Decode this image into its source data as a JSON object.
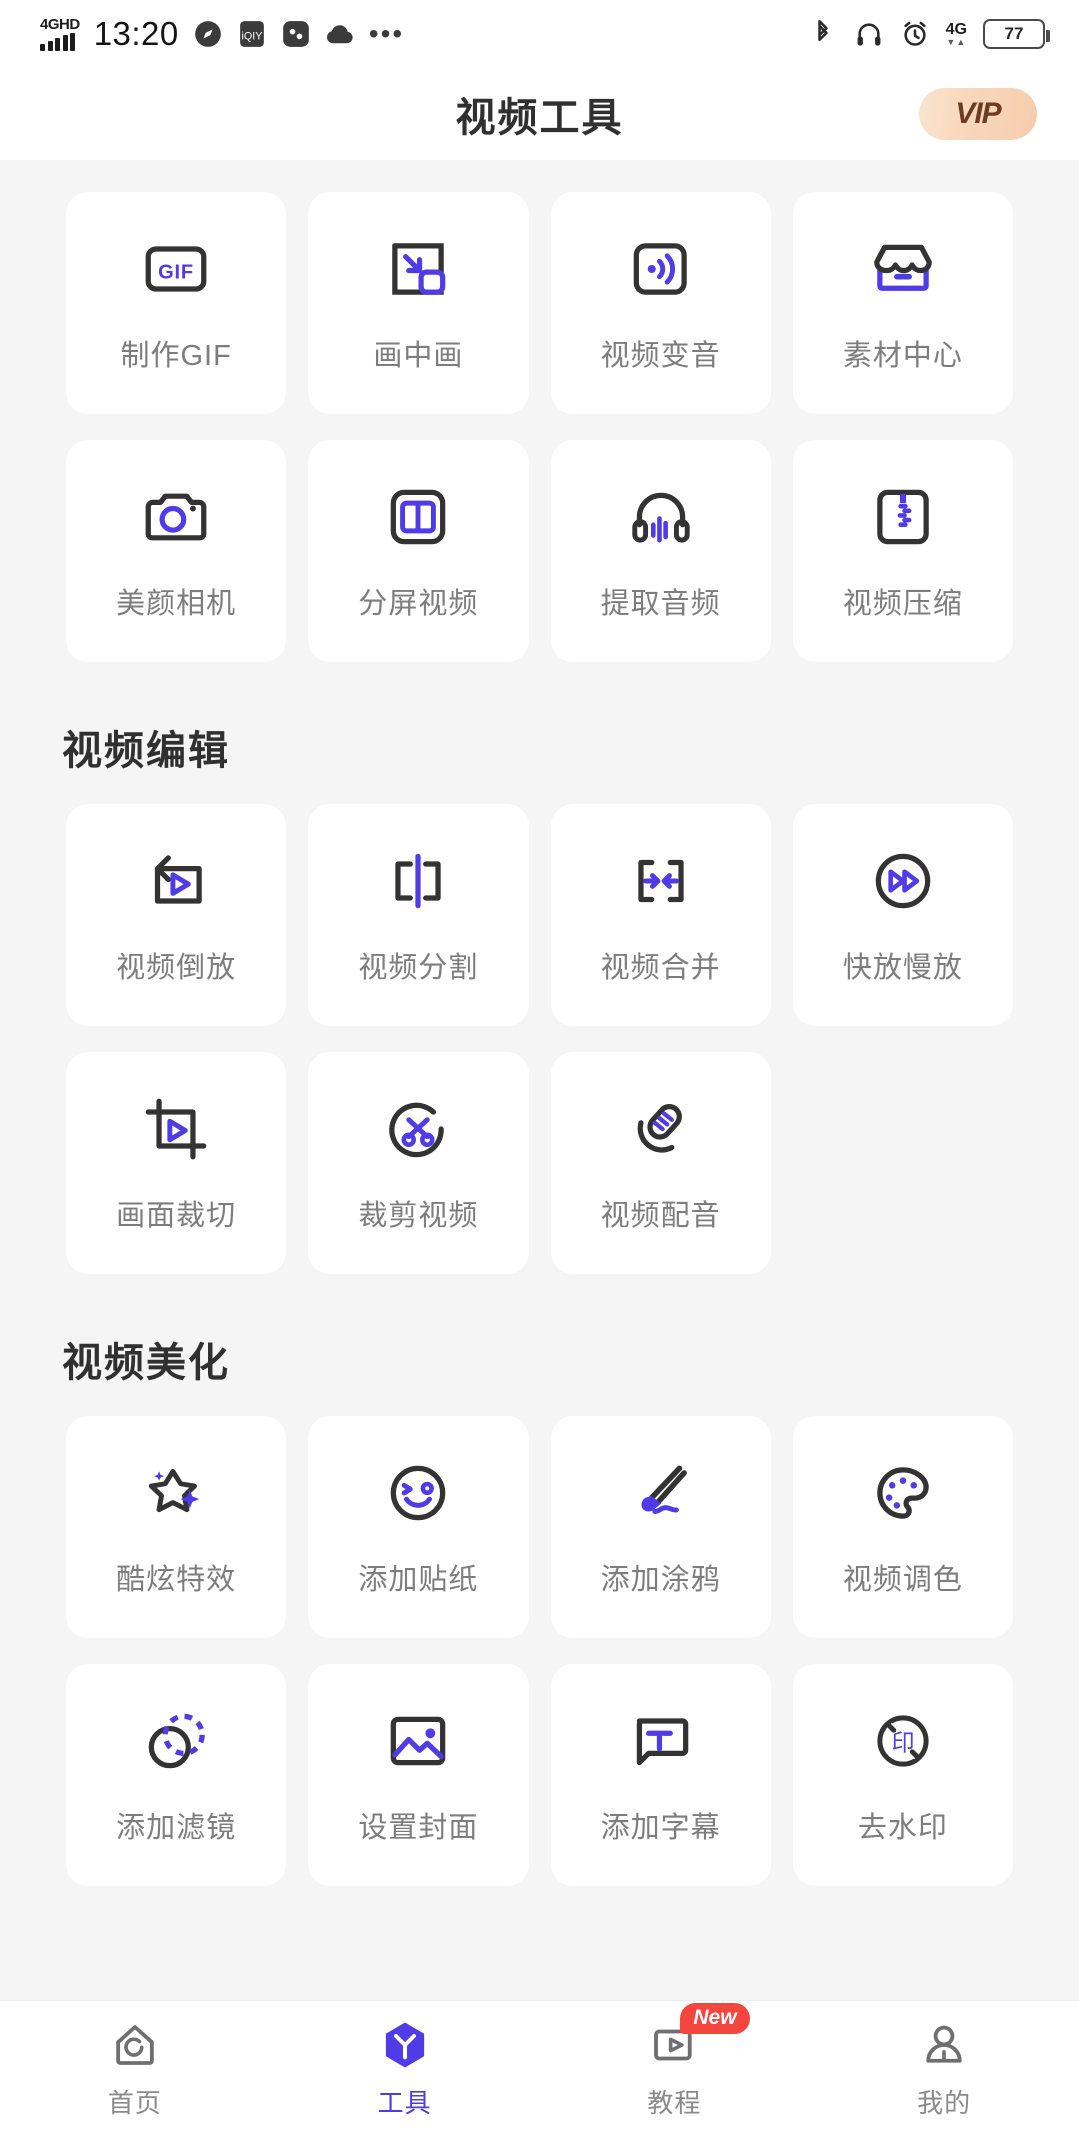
{
  "statusbar": {
    "network_label": "4GHD",
    "time": "13:20",
    "icons": [
      "compass-icon",
      "iqiyi-icon",
      "app-icon",
      "cloud-icon",
      "more-dots-icon"
    ],
    "right_icons": [
      "bluetooth-icon",
      "headphones-icon",
      "alarm-icon"
    ],
    "net_type": "4G",
    "net_sub": "▼▲",
    "battery": "77"
  },
  "header": {
    "title": "视频工具",
    "vip_label": "VIP"
  },
  "sections": [
    {
      "title": "",
      "items": [
        {
          "label": "制作GIF",
          "icon": "gif-icon"
        },
        {
          "label": "画中画",
          "icon": "picture-in-picture-icon"
        },
        {
          "label": "视频变音",
          "icon": "voice-change-icon"
        },
        {
          "label": "素材中心",
          "icon": "store-icon"
        },
        {
          "label": "美颜相机",
          "icon": "camera-icon"
        },
        {
          "label": "分屏视频",
          "icon": "split-screen-icon"
        },
        {
          "label": "提取音频",
          "icon": "headphone-audio-icon"
        },
        {
          "label": "视频压缩",
          "icon": "compress-icon"
        }
      ]
    },
    {
      "title": "视频编辑",
      "items": [
        {
          "label": "视频倒放",
          "icon": "reverse-play-icon"
        },
        {
          "label": "视频分割",
          "icon": "split-icon"
        },
        {
          "label": "视频合并",
          "icon": "merge-icon"
        },
        {
          "label": "快放慢放",
          "icon": "speed-icon"
        },
        {
          "label": "画面裁切",
          "icon": "crop-icon"
        },
        {
          "label": "裁剪视频",
          "icon": "scissors-icon"
        },
        {
          "label": "视频配音",
          "icon": "microphone-icon"
        }
      ]
    },
    {
      "title": "视频美化",
      "items": [
        {
          "label": "酷炫特效",
          "icon": "star-sparkle-icon"
        },
        {
          "label": "添加贴纸",
          "icon": "sticker-icon"
        },
        {
          "label": "添加涂鸦",
          "icon": "brush-icon"
        },
        {
          "label": "视频调色",
          "icon": "palette-icon"
        },
        {
          "label": "添加滤镜",
          "icon": "filter-icon"
        },
        {
          "label": "设置封面",
          "icon": "image-icon"
        },
        {
          "label": "添加字幕",
          "icon": "subtitle-icon"
        },
        {
          "label": "去水印",
          "icon": "watermark-icon"
        }
      ]
    }
  ],
  "tabbar": [
    {
      "label": "首页",
      "icon": "home-icon",
      "active": false,
      "badge": ""
    },
    {
      "label": "工具",
      "icon": "tools-hexagon-icon",
      "active": true,
      "badge": ""
    },
    {
      "label": "教程",
      "icon": "tutorial-video-icon",
      "active": false,
      "badge": "New"
    },
    {
      "label": "我的",
      "icon": "profile-icon",
      "active": false,
      "badge": ""
    }
  ],
  "colors": {
    "accent": "#4f3ce8",
    "icon_dark": "#333333",
    "label_gray": "#7d7d7d",
    "badge_red": "#f5453f",
    "bg": "#f5f5f5"
  }
}
